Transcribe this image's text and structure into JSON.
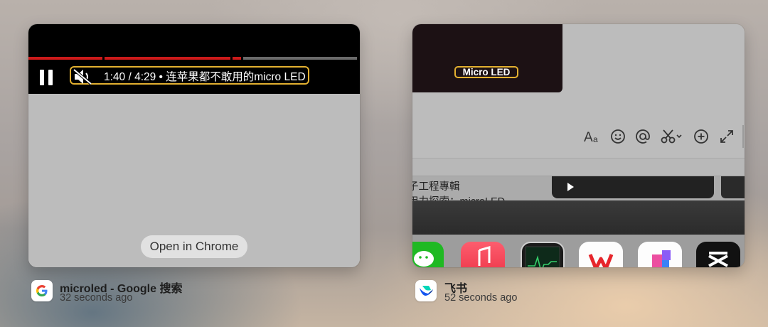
{
  "windows": [
    {
      "app": "Google Chrome",
      "title": "microled - Google 搜索",
      "time_ago": "32 seconds ago",
      "video": {
        "time_display": "1:40 / 4:29 • 连苹果都不敢用的micro LED",
        "progress_segments_color": "#cc1a1a"
      },
      "open_button_label": "Open in Chrome"
    },
    {
      "app": "飞书",
      "title": "飞书",
      "time_ago": "52 seconds ago",
      "video_tag": "Micro LED",
      "message_line_1": "子工程專輯",
      "message_line_2": "用力探索：microLED",
      "toolbar_icons": [
        "text-format-icon",
        "emoji-icon",
        "mention-icon",
        "scissors-icon",
        "add-icon",
        "expand-icon"
      ],
      "dock_apps": [
        "wechat-app-icon",
        "music-app-icon",
        "activity-monitor-app-icon",
        "wps-app-icon",
        "pages-app-icon",
        "capcut-app-icon"
      ]
    }
  ],
  "colors": {
    "highlight": "#e3b030",
    "progress_red": "#cc1a1a"
  }
}
